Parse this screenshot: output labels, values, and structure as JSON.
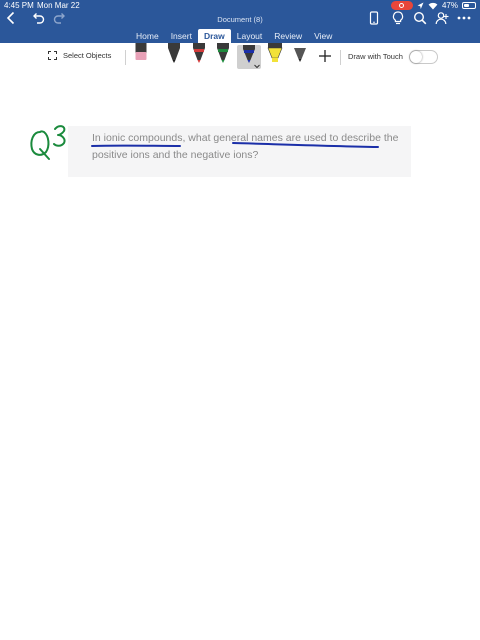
{
  "status_bar": {
    "time": "4:45 PM",
    "date": "Mon Mar 22",
    "battery": "47%"
  },
  "document": {
    "title": "Document (8)"
  },
  "tabs": [
    {
      "label": "Home",
      "active": false
    },
    {
      "label": "Insert",
      "active": false
    },
    {
      "label": "Draw",
      "active": true
    },
    {
      "label": "Layout",
      "active": false
    },
    {
      "label": "Review",
      "active": false
    },
    {
      "label": "View",
      "active": false
    }
  ],
  "ribbon": {
    "select_objects_label": "Select Objects",
    "draw_with_touch_label": "Draw with Touch",
    "draw_with_touch_enabled": false,
    "tools": [
      {
        "name": "eraser",
        "color": "#e8a1b7"
      },
      {
        "name": "pen",
        "color": "#1a1a1a"
      },
      {
        "name": "pen",
        "color": "#d23b3b"
      },
      {
        "name": "pen",
        "color": "#1f8a3d"
      },
      {
        "name": "pen",
        "color": "#1b2fa8",
        "selected": true
      },
      {
        "name": "highlighter",
        "color": "#f2e23a"
      },
      {
        "name": "pencil",
        "color": "#333333"
      }
    ]
  },
  "content": {
    "handwritten_label": "Q3",
    "question_line1": "In ionic compounds, what general names are used to describe the",
    "question_line2": "positive ions and the negative ions?"
  },
  "ink_colors": {
    "green_ink": "#1a8a3c",
    "blue_ink": "#1b2fa8"
  },
  "colors": {
    "header_blue": "#2b579a",
    "recording_red": "#e8463a"
  }
}
